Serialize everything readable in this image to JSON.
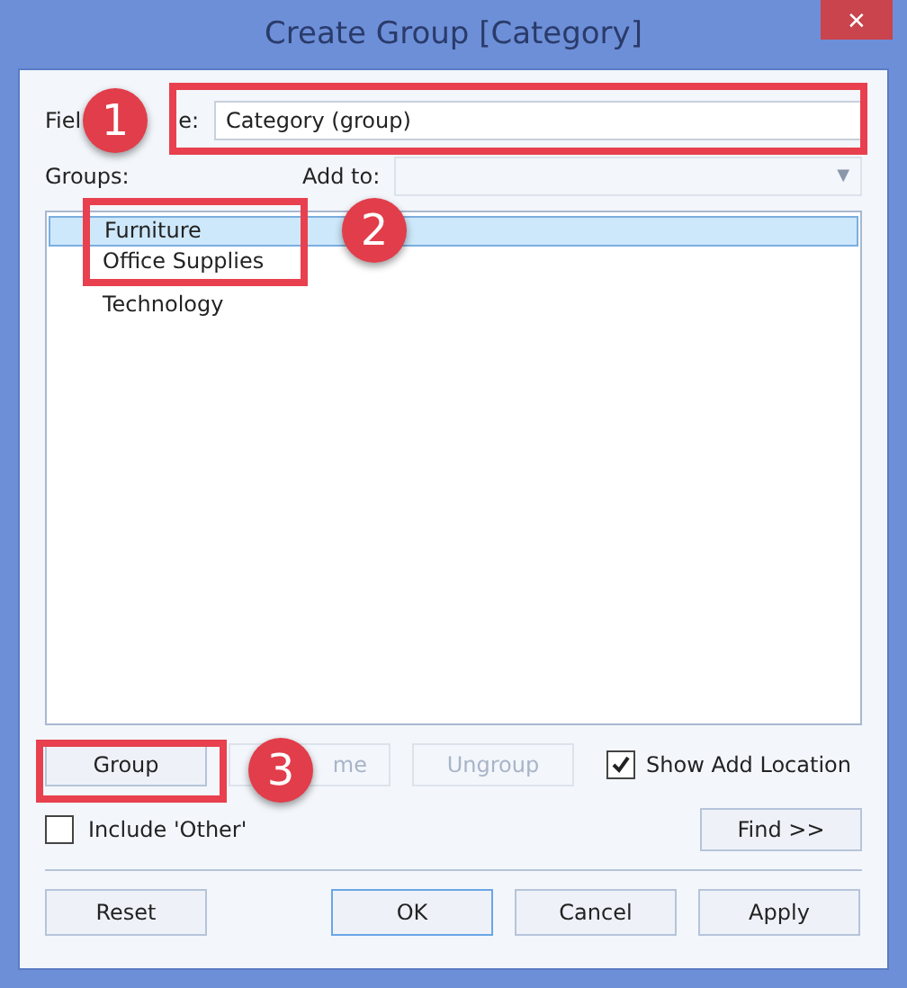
{
  "window": {
    "title": "Create Group [Category]",
    "close": "✕"
  },
  "field_name": {
    "label_parts": [
      "Fiel",
      "e:"
    ],
    "value": "Category (group)"
  },
  "groups_label": "Groups:",
  "add_to": {
    "label": "Add to:",
    "arrow": "▼"
  },
  "groups": [
    {
      "label": "Furniture",
      "selected": true
    },
    {
      "label": "Office Supplies",
      "selected": false
    },
    {
      "label": "Technology",
      "selected": false
    }
  ],
  "actions": [
    {
      "label": "Group",
      "disabled": false
    },
    {
      "label": "me",
      "disabled": true
    },
    {
      "label": "Ungroup",
      "disabled": true
    }
  ],
  "show_add_location": {
    "label": "Show Add Location",
    "checked": true
  },
  "include_other": {
    "label": "Include 'Other'",
    "checked": false
  },
  "find_button": "Find >>",
  "footer_buttons": [
    {
      "label": "Reset",
      "default": false
    },
    {
      "label": "OK",
      "default": true
    },
    {
      "label": "Cancel",
      "default": false
    },
    {
      "label": "Apply",
      "default": false
    }
  ],
  "callouts": [
    "1",
    "2",
    "3"
  ]
}
